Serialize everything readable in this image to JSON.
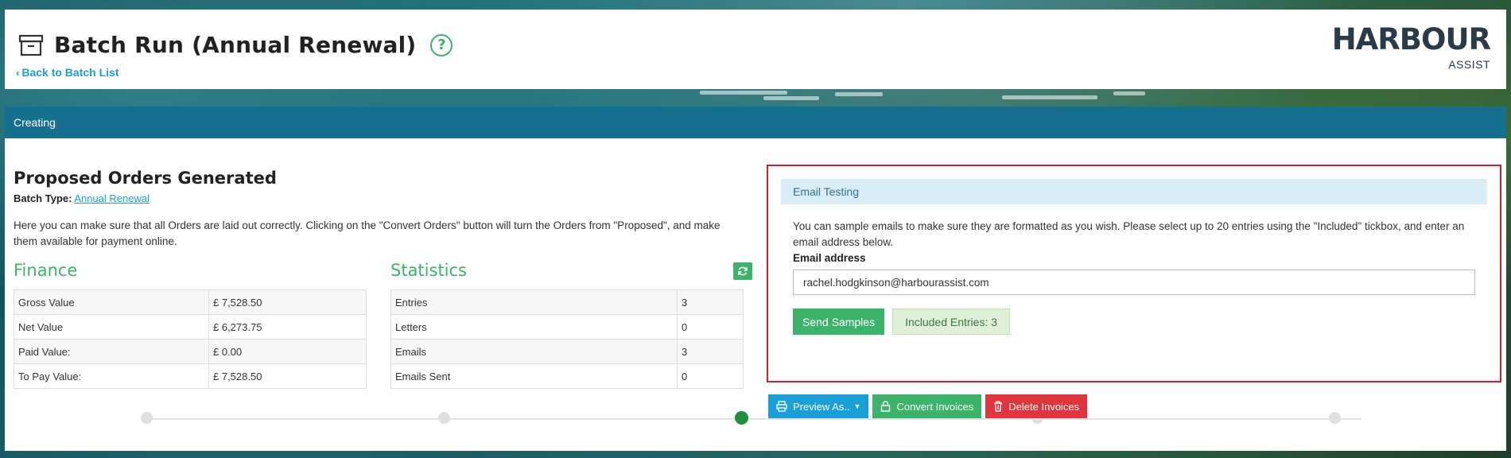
{
  "header": {
    "title": "Batch Run (Annual Renewal)",
    "back_link": "Back to Batch List",
    "logo_main": "HARBOUR",
    "logo_sub": "ASSIST"
  },
  "status": {
    "label": "Creating"
  },
  "proposed": {
    "title": "Proposed Orders Generated",
    "batch_type_label": "Batch Type:",
    "batch_type_value": "Annual Renewal",
    "description": "Here you can make sure that all Orders are laid out correctly. Clicking on the \"Convert Orders\" button will turn the Orders from \"Proposed\", and make them available for payment online."
  },
  "finance": {
    "title": "Finance",
    "rows": [
      {
        "label": "Gross Value",
        "value": "£ 7,528.50"
      },
      {
        "label": "Net Value",
        "value": "£ 6,273.75"
      },
      {
        "label": "Paid Value:",
        "value": "£ 0.00"
      },
      {
        "label": "To Pay Value:",
        "value": "£ 7,528.50"
      }
    ]
  },
  "statistics": {
    "title": "Statistics",
    "refresh_icon": "refresh-icon",
    "rows": [
      {
        "label": "Entries",
        "value": "3"
      },
      {
        "label": "Letters",
        "value": "0"
      },
      {
        "label": "Emails",
        "value": "3"
      },
      {
        "label": "Emails Sent",
        "value": "0"
      }
    ]
  },
  "email_testing": {
    "header": "Email Testing",
    "text": "You can sample emails to make sure they are formatted as you wish. Please select up to 20 entries using the \"Included\" tickbox, and enter an email address below.",
    "email_label": "Email address",
    "email_value": "rachel.hodgkinson@harbourassist.com",
    "send_button": "Send Samples",
    "included_entries": "Included Entries: 3"
  },
  "actions": {
    "preview": "Preview As..",
    "convert": "Convert Invoices",
    "delete": "Delete Invoices"
  },
  "stepper": {
    "steps": 5,
    "active_step": 3
  },
  "colors": {
    "accent_green": "#3bb36a",
    "status_bar": "#156f8e",
    "link_blue": "#1a9fd6",
    "danger_red": "#e0353e",
    "highlight_border": "#cf1f2a"
  }
}
